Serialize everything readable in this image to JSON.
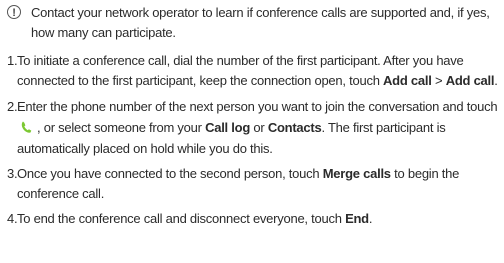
{
  "note": {
    "icon": "info-icon",
    "text": "Contact your network operator to learn if conference calls are supported and, if yes, how many can participate."
  },
  "steps": [
    {
      "num": "1.",
      "a": "To initiate a conference call, dial the number of the first participant. After you have connected to the first participant, keep the connection open, touch ",
      "b1": "Add call",
      "sep": " > ",
      "b2": "Add call",
      "end": "."
    },
    {
      "num": "2.",
      "a": "Enter the phone number of the next person you want to join the conversation and touch",
      "icon": "phone-call-icon",
      "b": ", or select someone from your ",
      "b1": "Call log",
      "or": " or ",
      "b2": "Contacts",
      "end": ". The first participant is automatically placed on hold while you do this."
    },
    {
      "num": "3.",
      "a": "Once you have connected to the second person, touch ",
      "b1": "Merge calls",
      "end": " to begin the conference call."
    },
    {
      "num": "4.",
      "a": "To end the conference call and disconnect everyone, touch ",
      "b1": "End",
      "end": "."
    }
  ],
  "colors": {
    "call_icon": "#7cc832",
    "text": "#2b2b2b"
  }
}
